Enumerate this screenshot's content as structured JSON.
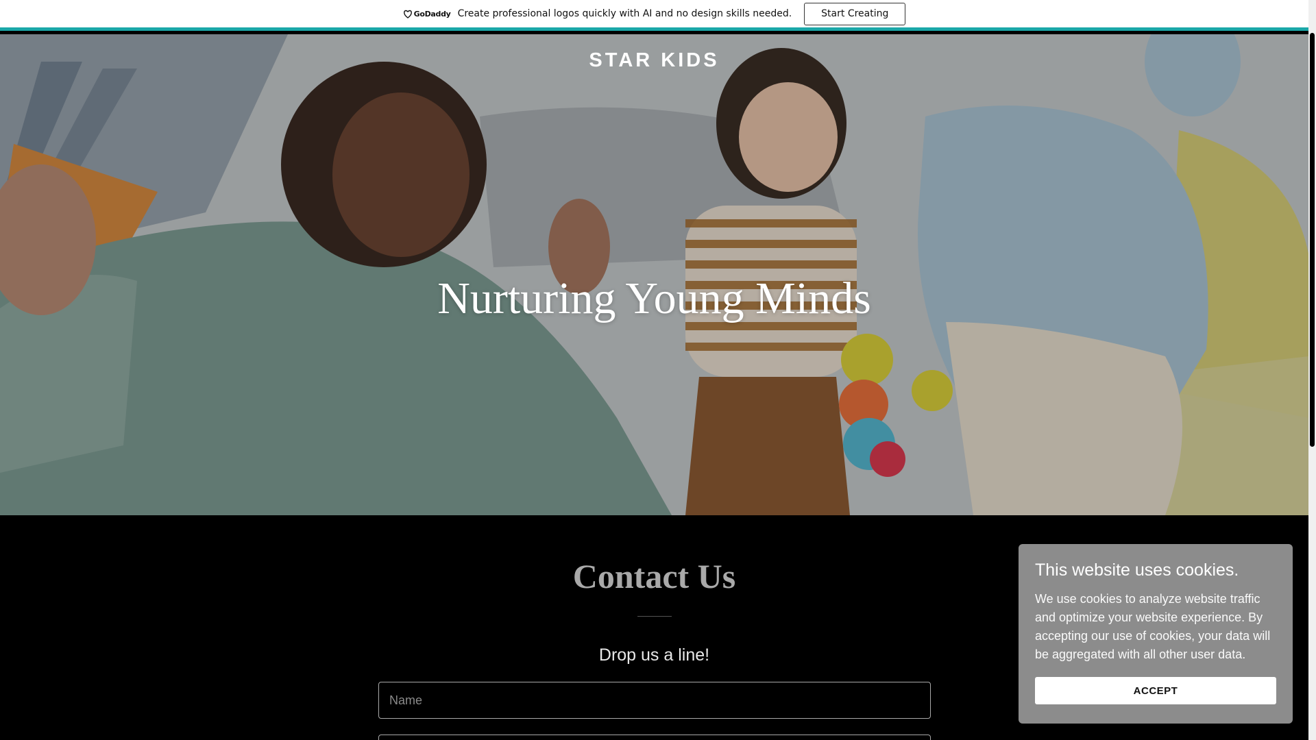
{
  "promo": {
    "brand": "GoDaddy",
    "text": "Create professional logos quickly with AI and no design skills needed.",
    "button_label": "Start Creating",
    "accent_color": "#1ba7a8"
  },
  "hero": {
    "site_title": "STAR KIDS",
    "heading": "Nurturing Young Minds"
  },
  "contact": {
    "title": "Contact Us",
    "subtitle": "Drop us a line!",
    "name_placeholder": "Name",
    "email_placeholder": ""
  },
  "cookie": {
    "title": "This website uses cookies.",
    "body": "We use cookies to analyze website traffic and optimize your website experience. By accepting our use of cookies, your data will be aggregated with all other user data.",
    "accept_label": "ACCEPT"
  }
}
